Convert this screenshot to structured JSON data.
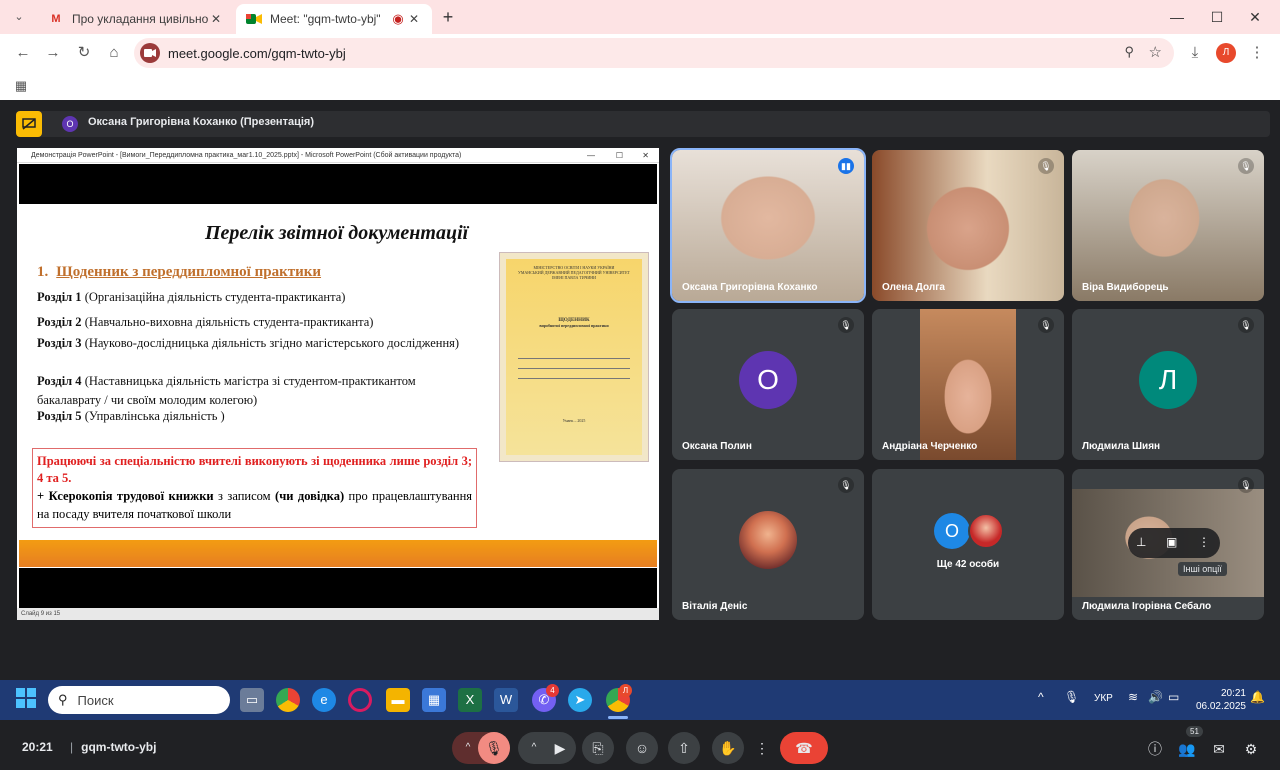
{
  "browser": {
    "tabs": [
      {
        "label": "Про укладання цивільно-прав",
        "icon": "gmail-icon"
      },
      {
        "label": "Meet: \"gqm-twto-ybj\"",
        "icon": "meet-icon",
        "recording": true
      }
    ],
    "new_tab": "+",
    "url": "meet.google.com/gqm-twto-ybj",
    "profile_initial": "Л",
    "window_controls": [
      "minimize",
      "maximize",
      "close"
    ]
  },
  "meet": {
    "presenter_avatar": "О",
    "presenter_label": "Оксана Григорівна Коханко (Презентація)",
    "presentation": {
      "window_title": "Демонстрація PowerPoint - [Вимоги_Переддипломна практика_маг1.10_2025.pptx] - Microsoft PowerPoint (Сбой активации продукта)",
      "status": "Слайд 9 из 15",
      "slide": {
        "title": "Перелік звітної документації",
        "heading_num": "1.",
        "heading": "Щоденник з переддипломної практики",
        "sections": [
          {
            "label": "Розділ 1",
            "text": " (Організаційна діяльність студента-практиканта)"
          },
          {
            "label": "Розділ 2",
            "text": " (Навчально-виховна діяльність студента-практиканта)"
          },
          {
            "label": "Розділ 3",
            "text": " (Науково-дослідницька діяльність згідно магістерського дослідження)"
          },
          {
            "label": "Розділ 4",
            "text": " (Наставницька діяльність магістра зі студентом-практикантом бакалаврату / чи своїм молодим колегою)"
          },
          {
            "label": "Розділ 5",
            "text": " (Управлінська діяльність )"
          }
        ],
        "box_red": "Працюючі за спеціальністю вчителі виконують зі щоденника лише розділ 3; 4 та 5.",
        "box_plus": "+ ",
        "box_bold1": "Ксерокопія трудової книжки",
        "box_mid": " з записом ",
        "box_bold2": "(чи довідка)",
        "box_end": " про працевлаштування на посаду вчителя початкової школи",
        "doc_lines": [
          "МІНІСТЕРСТВО ОСВІТИ І НАУКИ УКРАЇНИ",
          "УМАНСЬКИЙ ДЕРЖАВНИЙ ПЕДАГОГІЧНИЙ УНІВЕРСИТЕТ",
          "ІМЕНІ ПАВЛА ТИЧИНИ",
          "ЩОДЕННИК",
          "виробничої переддипломної практики",
          "Умань – 2025"
        ]
      }
    },
    "participants": [
      {
        "name": "Оксана Григорівна Коханко",
        "type": "video",
        "speaking": true,
        "bg": "#c9b8a6"
      },
      {
        "name": "Олена Долга",
        "type": "video",
        "muted": true,
        "bg": "#8a5a3a"
      },
      {
        "name": "Віра Видиборець",
        "type": "video",
        "muted": true,
        "bg": "#a7a29a"
      },
      {
        "name": "Оксана Полин",
        "type": "avatar",
        "initial": "О",
        "color": "#5e35b1",
        "muted": true
      },
      {
        "name": "Андріана Черченко",
        "type": "video",
        "muted": true,
        "bg": "#b07a5a"
      },
      {
        "name": "Людмила Шиян",
        "type": "avatar",
        "initial": "Л",
        "color": "#00897b",
        "muted": true
      },
      {
        "name": "Віталія Деніс",
        "type": "photo",
        "muted": true,
        "color": "#c04050"
      },
      {
        "name": "Ще 42 особи",
        "type": "group",
        "initial": "О",
        "color": "#1e88e5"
      },
      {
        "name": "Людмила Ігорівна Себало",
        "type": "video",
        "muted": true,
        "bg": "#6b6258"
      }
    ],
    "tooltip": "Інші опції",
    "clock": "20:21",
    "meeting_code": "gqm-twto-ybj",
    "people_count": "51",
    "accent_end_call": "#ea4335"
  },
  "taskbar": {
    "search_placeholder": "Поиск",
    "lang": "УКР",
    "time": "20:21",
    "date": "06.02.2025",
    "viber_badge": "4",
    "chrome_badge": "Л"
  }
}
